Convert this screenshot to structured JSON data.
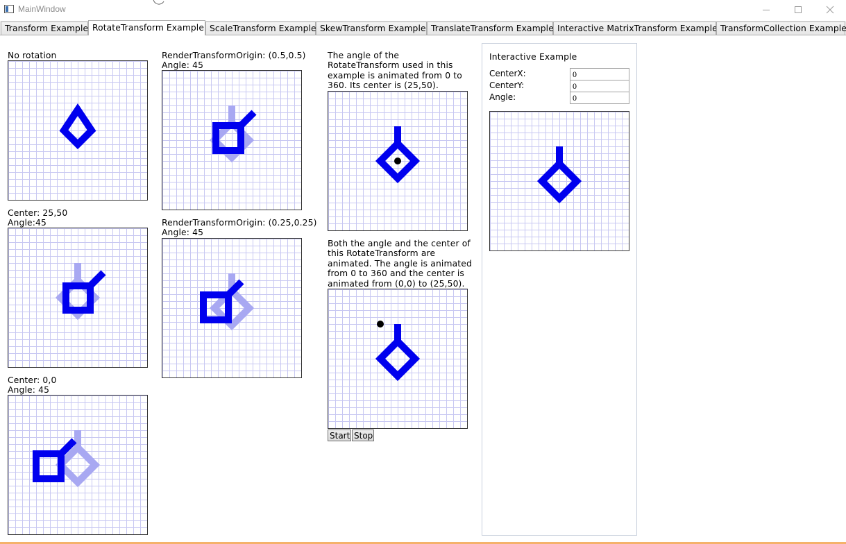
{
  "window": {
    "title": "MainWindow",
    "icons": {
      "app": "app-window-icon",
      "minimize": "minimize-icon",
      "maximize": "maximize-icon",
      "close": "close-icon"
    }
  },
  "tabs": [
    {
      "label": "Transform Example",
      "active": false
    },
    {
      "label": "RotateTransform Example",
      "active": true
    },
    {
      "label": "ScaleTransform Example",
      "active": false
    },
    {
      "label": "SkewTransform Example",
      "active": false
    },
    {
      "label": "TranslateTransform Example",
      "active": false
    },
    {
      "label": "Interactive MatrixTransform Example",
      "active": false
    },
    {
      "label": "TransformCollection Example",
      "active": false
    }
  ],
  "examples": {
    "no_rotation": {
      "label": "No rotation"
    },
    "center_25_50": {
      "line1": "Center: 25,50",
      "line2": "Angle:45"
    },
    "center_0_0": {
      "line1": "Center: 0,0",
      "line2": "Angle: 45"
    },
    "origin_half": {
      "line1": "RenderTransformOrigin: (0.5,0.5)",
      "line2": "Angle: 45"
    },
    "origin_quarter": {
      "line1": "RenderTransformOrigin: (0.25,0.25)",
      "line2": "Angle: 45"
    },
    "animated_angle": {
      "lines": [
        "The angle of the",
        "RotateTransform used in this",
        "example is animated from 0 to",
        "360. Its center is (25,50)."
      ]
    },
    "animated_both": {
      "lines": [
        "Both the angle and the center of",
        "this RotateTransform are",
        "animated. The angle is animated",
        "from 0 to 360 and the center is",
        "animated from (0,0) to (25,50)."
      ]
    }
  },
  "controls": {
    "start_label": "Start",
    "stop_label": "Stop"
  },
  "interactive": {
    "title": "Interactive Example",
    "centerx_label": "CenterX:",
    "centerx_value": "0",
    "centery_label": "CenterY:",
    "centery_value": "0",
    "angle_label": "Angle:",
    "angle_value": "0"
  },
  "colors": {
    "shape": "#0000ee",
    "ghost": "#a8a8f2",
    "grid_line": "#c8c8f2",
    "center_dot": "#000000",
    "accent_line": "#f5b26b"
  }
}
